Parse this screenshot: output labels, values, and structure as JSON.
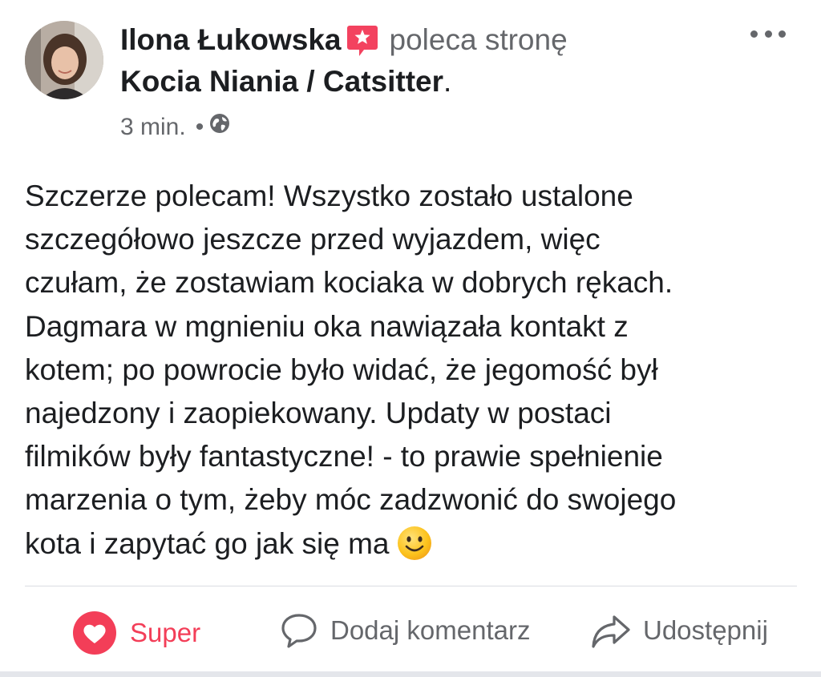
{
  "post": {
    "author": "Ilona Łukowska",
    "action": "poleca stronę",
    "page_name": "Kocia Niania / Catsitter",
    "page_suffix": ".",
    "time": "3 min.",
    "separator": "•",
    "privacy_icon": "globe-icon",
    "body_lines": [
      "Szczerze polecam! Wszystko zostało ustalone",
      "szczegółowo jeszcze przed wyjazdem, więc",
      "czułam, że zostawiam kociaka w dobrych rękach.",
      "Dagmara w mgnieniu oka nawiązała kontakt z",
      "kotem; po powrocie było widać, że jegomość był",
      "najedzony i zaopiekowany. Updaty w postaci",
      "filmików były fantastyczne! - to prawie spełnienie",
      "marzenia o tym, żeby móc zadzwonić do swojego",
      "kota i zapytać go jak się ma"
    ],
    "emoji": "smiling-face-icon"
  },
  "actions": {
    "super": "Super",
    "comment": "Dodaj komentarz",
    "share": "Udostępnij"
  },
  "colors": {
    "text": "#1c1e21",
    "secondary": "#65676b",
    "super": "#f33e58",
    "badge": "#f3425f",
    "divider": "#dadde1"
  }
}
